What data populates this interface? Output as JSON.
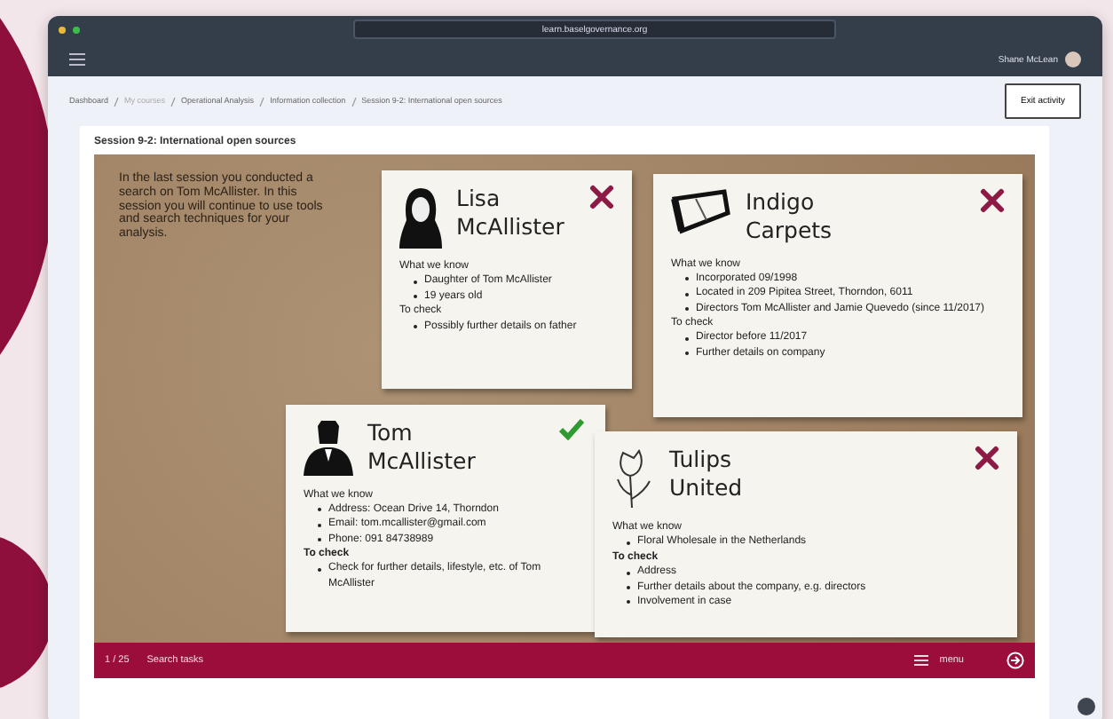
{
  "browser": {
    "url": "learn.baselgovernance.org"
  },
  "app_bar": {
    "user": "Shane McLean"
  },
  "breadcrumb": [
    {
      "label": "Dashboard",
      "muted": false
    },
    {
      "label": "My courses",
      "muted": true
    },
    {
      "label": "Operational Analysis",
      "muted": false
    },
    {
      "label": "Information collection",
      "muted": false
    },
    {
      "label": "Session 9-2: International open sources",
      "muted": false
    }
  ],
  "exit_button": "Exit activity",
  "section_title": "Session 9-2: International open sources",
  "intro": "In the last session you conducted a search on Tom McAllister. In this session you will continue to use tools and search techniques for your analysis.",
  "cards": [
    {
      "kind": "woman",
      "title": [
        "Lisa",
        "McAllister"
      ],
      "confirmed": false,
      "sections": [
        {
          "heading": "What we know",
          "bold": false,
          "items": [
            "Daughter of Tom McAllister",
            "19 years old"
          ]
        },
        {
          "heading": "To check",
          "bold": false,
          "items": [
            "Possibly further details on father"
          ]
        }
      ]
    },
    {
      "kind": "carpet",
      "title": [
        "Indigo",
        "Carpets"
      ],
      "confirmed": false,
      "sections": [
        {
          "heading": "What we know",
          "bold": false,
          "items": [
            "Incorporated 09/1998",
            "Located in 209 Pipitea Street, Thorndon, 6011",
            "Directors Tom McAllister and Jamie Quevedo (since 11/2017)"
          ]
        },
        {
          "heading": "To check",
          "bold": false,
          "items": [
            "Director before 11/2017",
            "Further details on company"
          ]
        }
      ]
    },
    {
      "kind": "man",
      "title": [
        "Tom",
        "McAllister"
      ],
      "confirmed": true,
      "sections": [
        {
          "heading": "What we know",
          "bold": false,
          "items": [
            "Address: Ocean Drive 14, Thorndon",
            "Email: tom.mcallister@gmail.com",
            "Phone: 091 84738989"
          ]
        },
        {
          "heading": "To check",
          "bold": true,
          "items": [
            "Check for further details, lifestyle, etc. of Tom McAllister"
          ]
        }
      ]
    },
    {
      "kind": "flower",
      "title": [
        "Tulips",
        "United"
      ],
      "confirmed": false,
      "sections": [
        {
          "heading": "What we know",
          "bold": false,
          "items": [
            "Floral Wholesale in the Netherlands"
          ]
        },
        {
          "heading": "To check",
          "bold": true,
          "items": [
            "Address",
            "Further details about the company, e.g. directors",
            "Involvement in case"
          ]
        }
      ]
    }
  ],
  "footer": {
    "counter": "1 / 25",
    "task": "Search tasks",
    "menu": "menu"
  }
}
